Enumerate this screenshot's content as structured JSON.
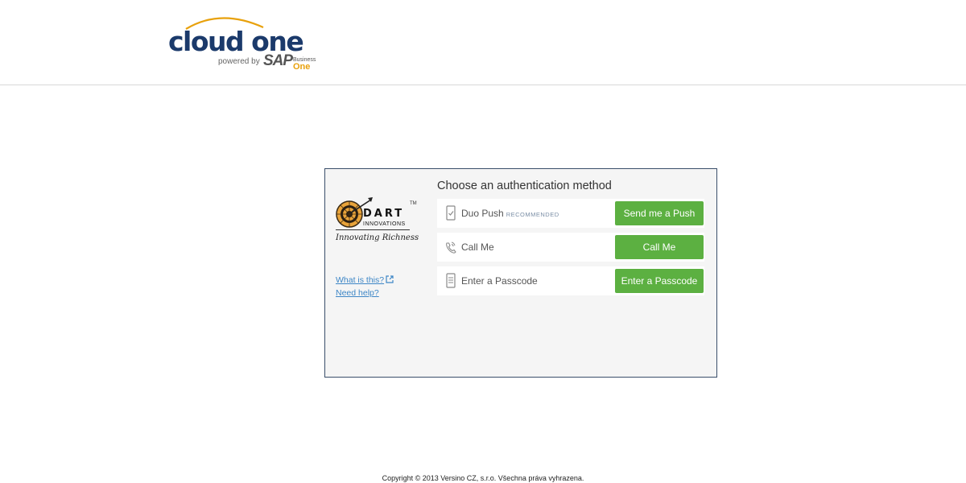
{
  "header": {
    "logo": {
      "main_text": "cloud one",
      "powered_by": "powered by",
      "sap": "SAP",
      "business": "Business",
      "one": "One"
    }
  },
  "auth": {
    "title": "Choose an authentication method",
    "brand": {
      "name": "DART",
      "sub": "INNOVATIONS",
      "tm": "TM",
      "tagline": "Innovating Richness"
    },
    "links": {
      "what_is_this": "What is this?",
      "need_help": "Need help?"
    },
    "methods": [
      {
        "label": "Duo Push",
        "badge": "RECOMMENDED",
        "button": "Send me a Push",
        "icon": "phone-check-icon"
      },
      {
        "label": "Call Me",
        "button": "Call Me",
        "icon": "phone-call-icon"
      },
      {
        "label": "Enter a Passcode",
        "button": "Enter a Passcode",
        "icon": "passcode-icon"
      }
    ]
  },
  "footer": {
    "copyright": "Copyright © 2013 Versino CZ, s.r.o. Všechna práva vyhrazena."
  },
  "colors": {
    "brand_navy": "#1b3a6b",
    "brand_gold": "#e8a10c",
    "button_green": "#5cb041",
    "link_blue": "#3d86c6",
    "frame_border": "#3a4e6a"
  }
}
